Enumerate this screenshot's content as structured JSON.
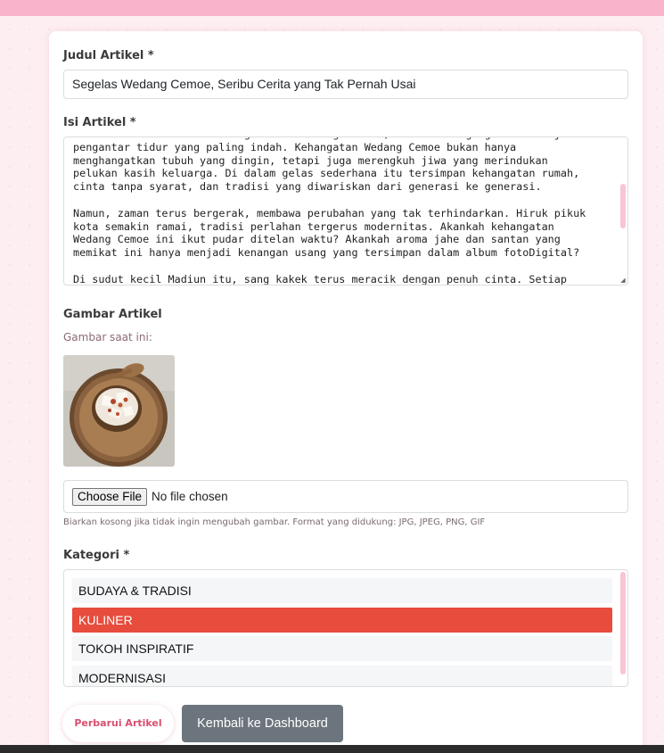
{
  "form": {
    "title_label": "Judul Artikel *",
    "title_value": "Segelas Wedang Cemoe, Seribu Cerita yang Tak Pernah Usai",
    "content_label": "Isi Artikel *",
    "content_lines": [
      "malam-malam bertabur bintang di bawah langit Jawa, di mana dongeng nenek menjadi",
      "pengantar tidur yang paling indah. Kehangatan Wedang Cemoe bukan hanya",
      "menghangatkan tubuh yang dingin, tetapi juga merengkuh jiwa yang merindukan",
      "pelukan kasih keluarga. Di dalam gelas sederhana itu tersimpan kehangatan rumah,",
      "cinta tanpa syarat, dan tradisi yang diwariskan dari generasi ke generasi.",
      "",
      "Namun, zaman terus bergerak, membawa perubahan yang tak terhindarkan. Hiruk pikuk",
      "kota semakin ramai, tradisi perlahan tergerus modernitas. Akankah kehangatan",
      "Wedang Cemoe ini ikut pudar ditelan waktu? Akankah aroma jahe dan santan yang",
      "memikat ini hanya menjadi kenangan usang yang tersimpan dalam album fotoDigital?",
      "",
      "Di sudut kecil Madiun itu, sang kakek terus meracik dengan penuh cinta. Setiap"
    ],
    "image_label": "Gambar Artikel",
    "current_image_label": "Gambar saat ini:",
    "choose_file_label": "Choose File",
    "file_status": "No file chosen",
    "help_text": "Biarkan kosong jika tidak ingin mengubah gambar. Format yang didukung: JPG, JPEG, PNG, GIF",
    "category_label": "Kategori *",
    "category_options": [
      {
        "label": "BUDAYA & TRADISI",
        "selected": false
      },
      {
        "label": "KULINER",
        "selected": true
      },
      {
        "label": "TOKOH INSPIRATIF",
        "selected": false
      },
      {
        "label": "MODERNISASI",
        "selected": false
      }
    ]
  },
  "actions": {
    "update_label": "Perbarui Artikel",
    "back_label": "Kembali ke Dashboard"
  },
  "colors": {
    "accent_pink": "#f9b3cb",
    "selected_red": "#e74c3c",
    "secondary_gray": "#6c757d",
    "update_text": "#d84f6f"
  }
}
